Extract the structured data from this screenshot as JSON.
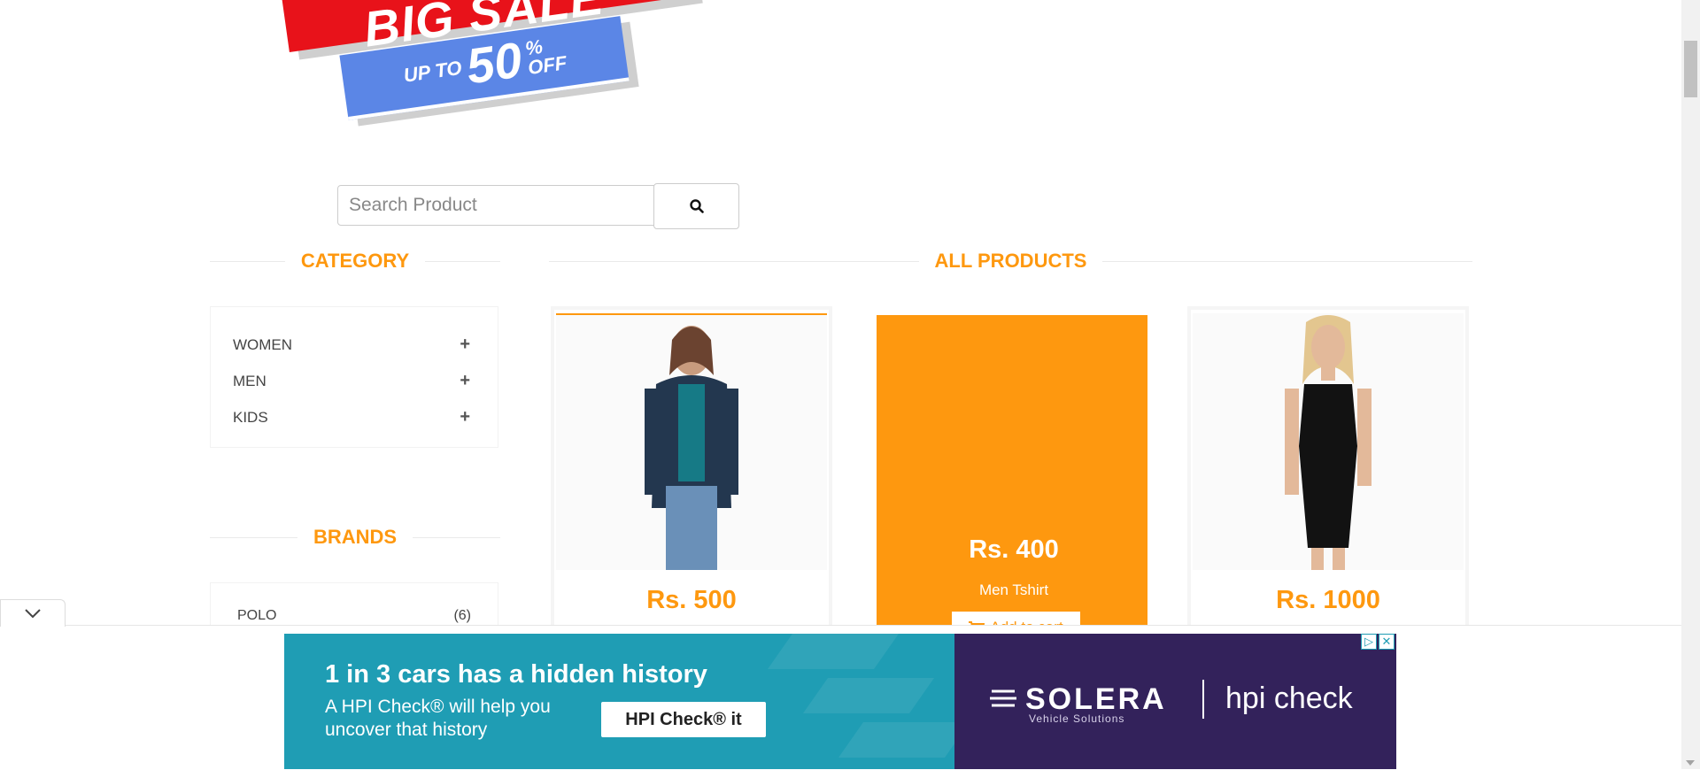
{
  "banner": {
    "big_text": "BIG SALE",
    "up_to": "UP TO",
    "percent": "50",
    "percent_suffix": "%",
    "off_text": "OFF"
  },
  "search": {
    "placeholder": "Search Product",
    "icon": "search-icon"
  },
  "category": {
    "title": "CATEGORY",
    "items": [
      {
        "label": "WOMEN",
        "icon": "plus-icon"
      },
      {
        "label": "MEN",
        "icon": "plus-icon"
      },
      {
        "label": "KIDS",
        "icon": "plus-icon"
      }
    ]
  },
  "brands": {
    "title": "BRANDS",
    "items": [
      {
        "label": "POLO",
        "count": "(6)"
      }
    ]
  },
  "products": {
    "title": "ALL PRODUCTS",
    "items": [
      {
        "price": "Rs. 500"
      },
      {
        "price": "Rs. 400",
        "name": "Men Tshirt",
        "cta": "Add to cart"
      },
      {
        "price": "Rs. 1000"
      }
    ]
  },
  "ad": {
    "headline": "1 in 3 cars has a hidden history",
    "sub": "A HPI Check® will help you uncover that history",
    "cta": "HPI Check® it",
    "brand": "SOLERA",
    "brand_sub": "Vehicle Solutions",
    "partner": "hpi check"
  },
  "colors": {
    "accent": "#fe980f",
    "ad_teal": "#1f9db4",
    "ad_purple": "#33225b",
    "banner_red": "#e8121a",
    "banner_blue": "#5b86e6"
  }
}
